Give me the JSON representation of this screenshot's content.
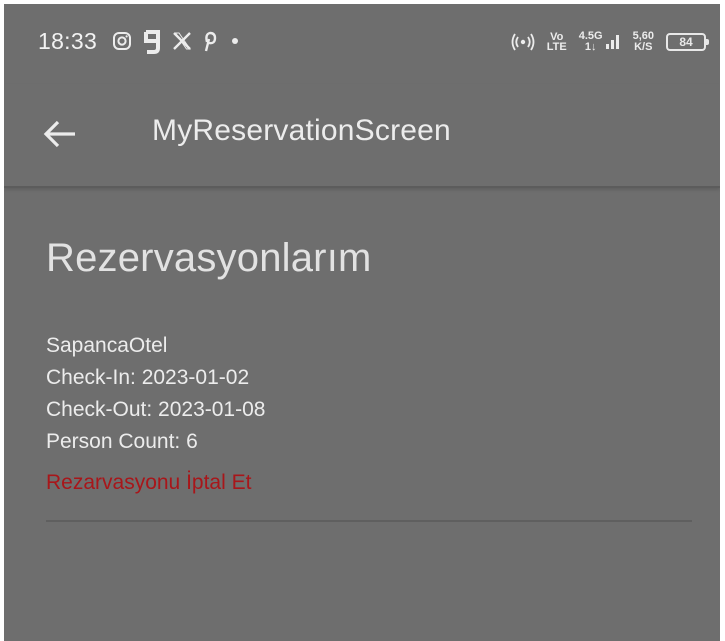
{
  "status_bar": {
    "time": "18:33",
    "left_icons": [
      "instagram-icon",
      "gettr-icon",
      "x-icon",
      "pinterest-icon",
      "dot-icon"
    ],
    "volte_top": "Vo",
    "volte_bottom": "LTE",
    "network_type": "4.5G",
    "network_sub": "1↓",
    "speed_value": "5,60",
    "speed_unit": "K/S",
    "battery_level": "84"
  },
  "app_bar": {
    "title": "MyReservationScreen",
    "back_icon": "arrow-left-icon"
  },
  "page": {
    "heading": "Rezervasyonlarım"
  },
  "reservations": [
    {
      "hotel": "SapancaOtel",
      "check_in": "Check-In: 2023-01-02",
      "check_out": "Check-Out: 2023-01-08",
      "person_count": "Person Count: 6",
      "cancel_label": "Rezarvasyonu İptal Et"
    }
  ],
  "colors": {
    "background": "#6e6e6e",
    "text": "#ececec",
    "cancel": "#a8161a"
  }
}
